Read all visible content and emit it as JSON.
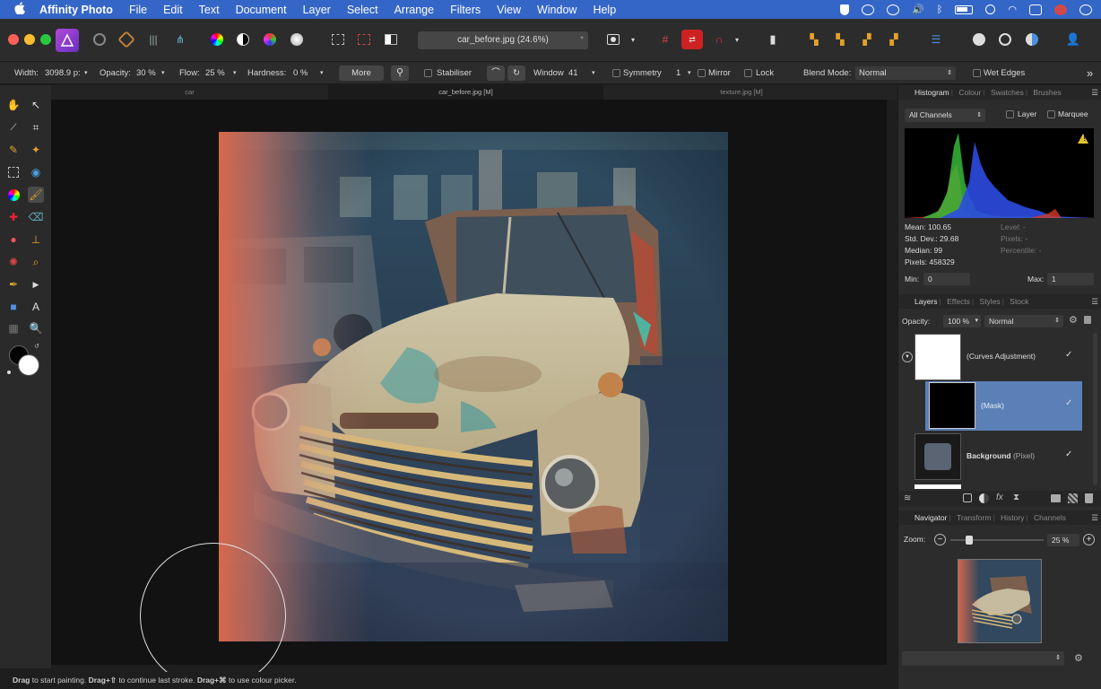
{
  "menubar": {
    "apple": "",
    "app_name": "Affinity Photo",
    "items": [
      "File",
      "Edit",
      "Text",
      "Document",
      "Layer",
      "Select",
      "Arrange",
      "Filters",
      "View",
      "Window",
      "Help"
    ]
  },
  "document_field": {
    "title": "car_before.jpg (24.6%)",
    "star": "*"
  },
  "context_toolbar": {
    "width_label": "Width:",
    "width_value": "3098.9 p:",
    "opacity_label": "Opacity:",
    "opacity_value": "30 %",
    "flow_label": "Flow:",
    "flow_value": "25 %",
    "hardness_label": "Hardness:",
    "hardness_value": "0 %",
    "more_label": "More",
    "stabiliser_label": "Stabiliser",
    "window_label": "Window",
    "window_value": "41",
    "symmetry_label": "Symmetry",
    "symmetry_value": "1",
    "mirror_label": "Mirror",
    "lock_label": "Lock",
    "blend_mode_label": "Blend Mode:",
    "blend_mode_value": "Normal",
    "wet_edges_label": "Wet Edges",
    "overflow": "»"
  },
  "document_tabs": [
    {
      "label": "car",
      "active": false
    },
    {
      "label": "car_before.jpg [M]",
      "active": true
    },
    {
      "label": "texture.jpg [M]",
      "active": false
    }
  ],
  "histogram_panel": {
    "tabs": [
      "Histogram",
      "Colour",
      "Swatches",
      "Brushes"
    ],
    "channels_value": "All Channels",
    "layer_label": "Layer",
    "marquee_label": "Marquee",
    "warning": "!",
    "stats": {
      "mean": "Mean: 100.65",
      "std_dev": "Std. Dev.: 29.68",
      "median": "Median: 99",
      "pixels": "Pixels: 458329",
      "level": "Level: -",
      "pixels_dim": "Pixels: -",
      "percentile": "Percentile: -"
    },
    "min_label": "Min:",
    "min_value": "0",
    "max_label": "Max:",
    "max_value": "1"
  },
  "layers_panel": {
    "tabs": [
      "Layers",
      "Effects",
      "Styles",
      "Stock"
    ],
    "opacity_label": "Opacity:",
    "opacity_value": "100 %",
    "blend_value": "Normal",
    "layers": [
      {
        "name": "(Curves Adjustment)",
        "checked": "✓"
      },
      {
        "name": "(Mask)",
        "checked": "✓"
      },
      {
        "name_bold": "Background",
        "name_suffix": "(Pixel)",
        "checked": "✓"
      }
    ]
  },
  "navigator_panel": {
    "tabs": [
      "Navigator",
      "Transform",
      "History",
      "Channels"
    ],
    "zoom_label": "Zoom:",
    "zoom_value": "25 %",
    "zoom_fraction": 0.2
  },
  "status": {
    "drag1": "Drag",
    "text1": " to start painting. ",
    "drag2": "Drag+⇧",
    "text2": " to continue last stroke. ",
    "drag3": "Drag+⌘",
    "text3": " to use colour picker."
  },
  "colors": {
    "menubar": "#3466c8",
    "selected_layer": "#5b80b8",
    "accent": "#4a90e2"
  }
}
